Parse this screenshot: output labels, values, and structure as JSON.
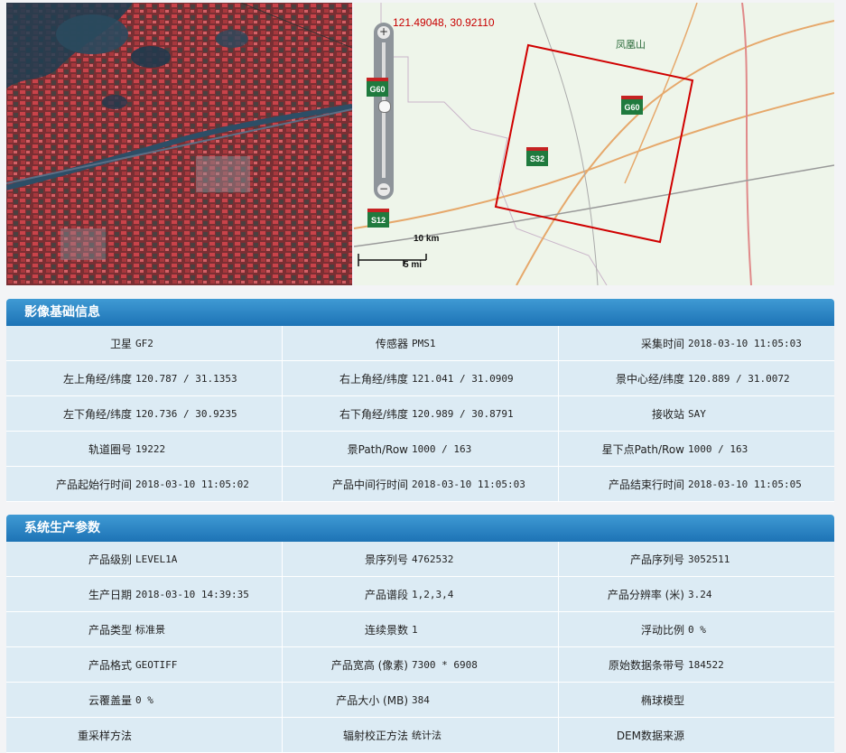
{
  "map": {
    "coordinate_readout": "121.49048, 30.92110",
    "zoom_in": "+",
    "zoom_out": "−",
    "scale_km": "10 km",
    "scale_mi": "5 mi",
    "place_label": "凤凰山",
    "road_signs": [
      "G60",
      "G60",
      "S32",
      "S12"
    ]
  },
  "basic_info": {
    "title": "影像基础信息",
    "rows": [
      [
        {
          "label": "卫星",
          "value": "GF2"
        },
        {
          "label": "传感器",
          "value": "PMS1"
        },
        {
          "label": "采集时间",
          "value": "2018-03-10 11:05:03"
        }
      ],
      [
        {
          "label": "左上角经/纬度",
          "value": "120.787 / 31.1353"
        },
        {
          "label": "右上角经/纬度",
          "value": "121.041 / 31.0909"
        },
        {
          "label": "景中心经/纬度",
          "value": "120.889 / 31.0072"
        }
      ],
      [
        {
          "label": "左下角经/纬度",
          "value": "120.736 / 30.9235"
        },
        {
          "label": "右下角经/纬度",
          "value": "120.989 / 30.8791"
        },
        {
          "label": "接收站",
          "value": "SAY"
        }
      ],
      [
        {
          "label": "轨道圈号",
          "value": "19222"
        },
        {
          "label": "景Path/Row",
          "value": "1000 / 163"
        },
        {
          "label": "星下点Path/Row",
          "value": "1000 / 163"
        }
      ],
      [
        {
          "label": "产品起始行时间",
          "value": "2018-03-10 11:05:02"
        },
        {
          "label": "产品中间行时间",
          "value": "2018-03-10 11:05:03"
        },
        {
          "label": "产品结束行时间",
          "value": "2018-03-10 11:05:05"
        }
      ]
    ]
  },
  "production": {
    "title": "系统生产参数",
    "rows": [
      [
        {
          "label": "产品级别",
          "value": "LEVEL1A"
        },
        {
          "label": "景序列号",
          "value": "4762532"
        },
        {
          "label": "产品序列号",
          "value": "3052511"
        }
      ],
      [
        {
          "label": "生产日期",
          "value": "2018-03-10 14:39:35"
        },
        {
          "label": "产品谱段",
          "value": "1,2,3,4"
        },
        {
          "label": "产品分辨率 (米)",
          "value": "3.24"
        }
      ],
      [
        {
          "label": "产品类型",
          "value": "标准景"
        },
        {
          "label": "连续景数",
          "value": "1"
        },
        {
          "label": "浮动比例",
          "value": "0 %"
        }
      ],
      [
        {
          "label": "产品格式",
          "value": "GEOTIFF"
        },
        {
          "label": "产品宽高 (像素)",
          "value": "7300 * 6908"
        },
        {
          "label": "原始数据条带号",
          "value": "184522"
        }
      ],
      [
        {
          "label": "云覆盖量",
          "value": "0 %"
        },
        {
          "label": "产品大小 (MB)",
          "value": "384"
        },
        {
          "label": "椭球模型",
          "value": ""
        }
      ],
      [
        {
          "label": "重采样方法",
          "value": ""
        },
        {
          "label": "辐射校正方法",
          "value": "统计法"
        },
        {
          "label": "DEM数据来源",
          "value": ""
        }
      ]
    ]
  }
}
